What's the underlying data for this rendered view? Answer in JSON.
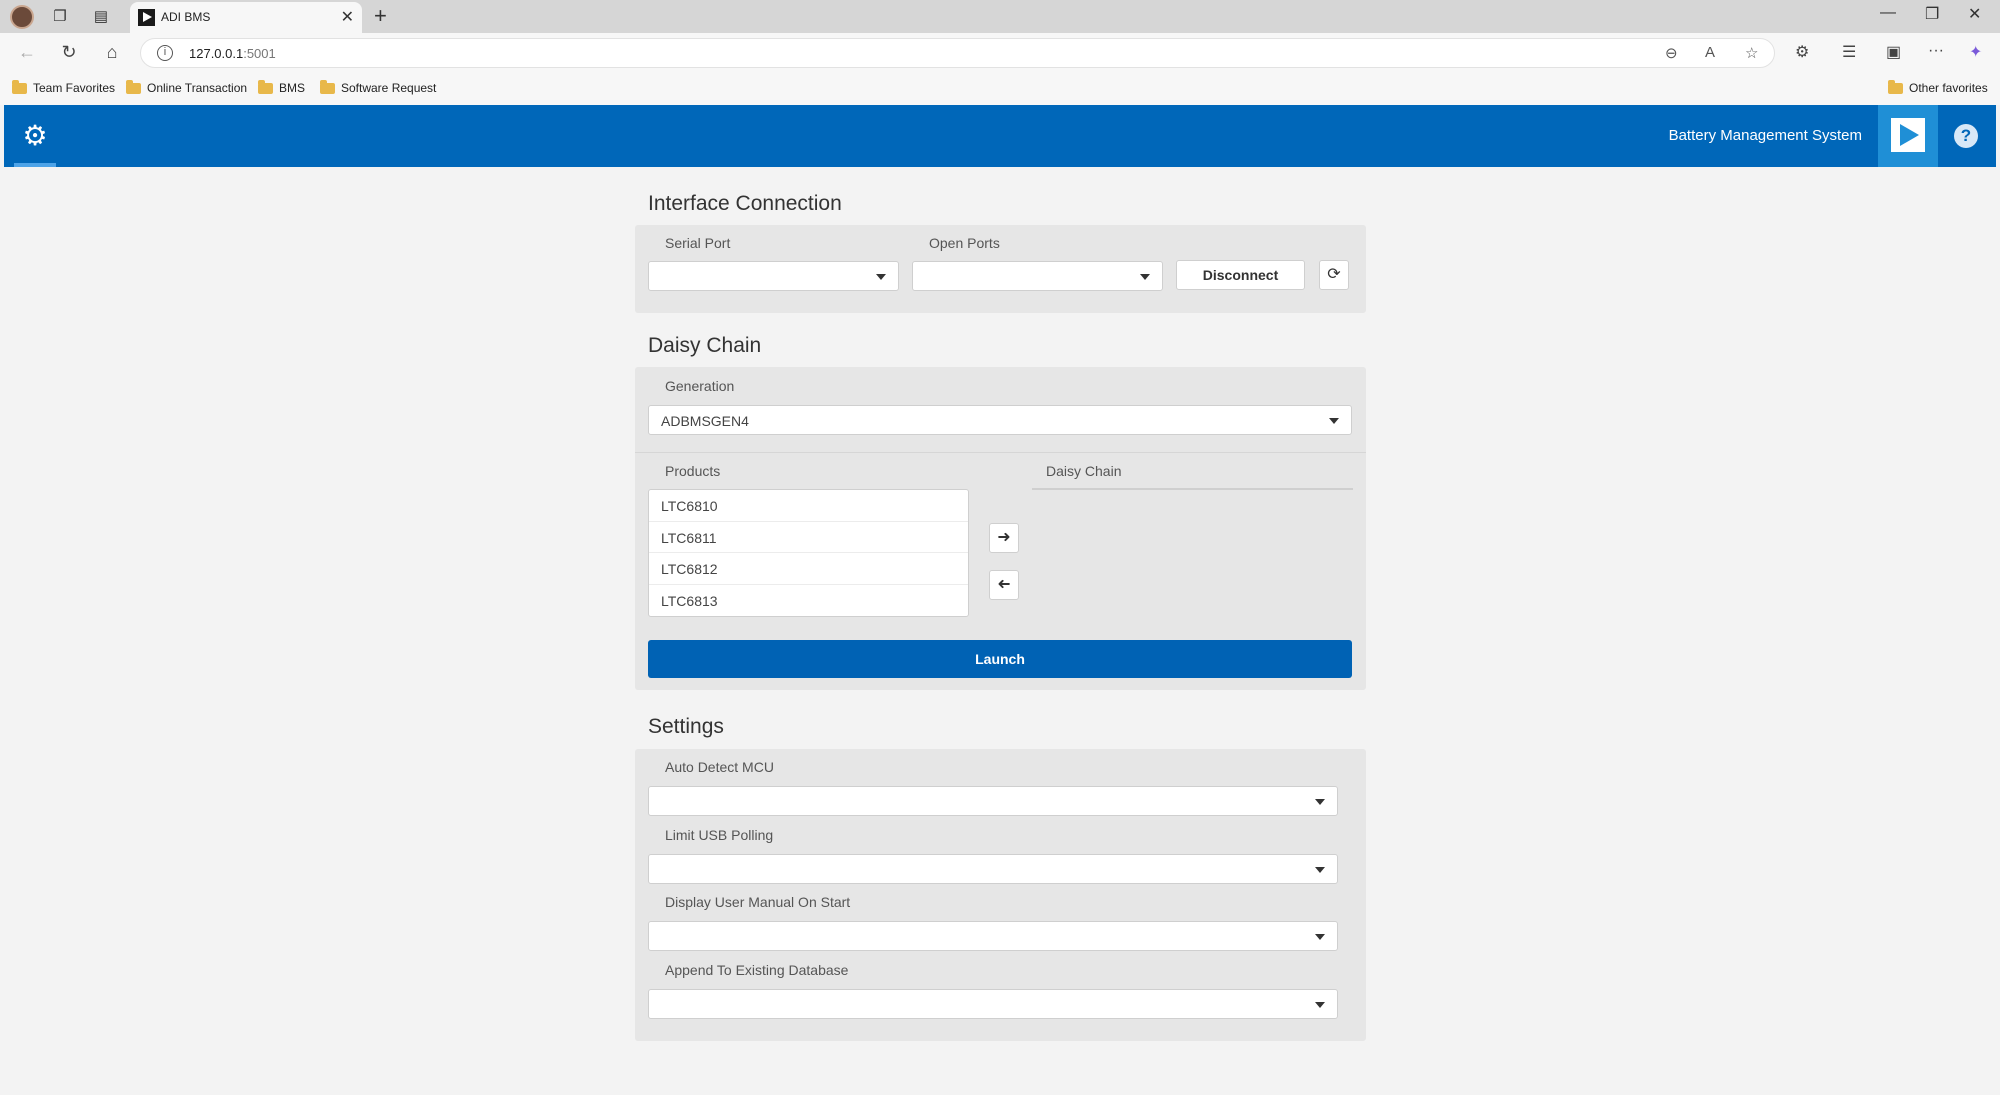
{
  "browser": {
    "tab_title": "ADI BMS",
    "url_host": "127.0.0.1",
    "url_port": ":5001",
    "bookmarks": [
      "Team Favorites",
      "Online Transaction",
      "BMS",
      "Software Request"
    ],
    "other_favorites": "Other favorites"
  },
  "app": {
    "title": "Battery Management System",
    "accent_color": "#0067b9"
  },
  "interface_connection": {
    "title": "Interface Connection",
    "serial_port_label": "Serial Port",
    "serial_port_value": "",
    "open_ports_label": "Open Ports",
    "open_ports_value": "",
    "disconnect_label": "Disconnect",
    "refresh_icon": "refresh-icon"
  },
  "daisy_chain": {
    "title": "Daisy Chain",
    "generation_label": "Generation",
    "generation_value": "ADBMSGEN4",
    "products_label": "Products",
    "products": [
      "LTC6810",
      "LTC6811",
      "LTC6812",
      "LTC6813"
    ],
    "chain_label": "Daisy Chain",
    "chain_items": [],
    "launch_label": "Launch"
  },
  "settings": {
    "title": "Settings",
    "fields": [
      {
        "label": "Auto Detect MCU",
        "value": ""
      },
      {
        "label": "Limit USB Polling",
        "value": ""
      },
      {
        "label": "Display User Manual On Start",
        "value": ""
      },
      {
        "label": "Append To Existing Database",
        "value": ""
      }
    ]
  }
}
